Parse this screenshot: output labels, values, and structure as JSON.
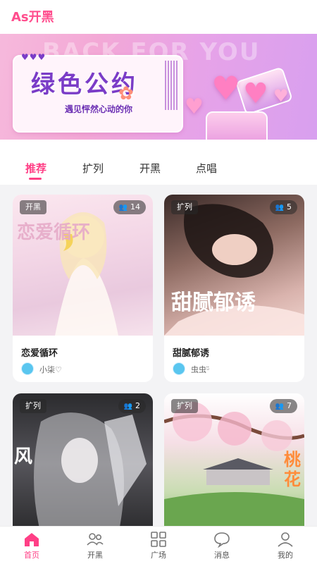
{
  "app": {
    "title": "As开黑"
  },
  "banner": {
    "ghost_text": "BACK FOR YOU",
    "title": "绿色公约",
    "subtitle": "遇见怦然心动的你"
  },
  "tabs": [
    {
      "label": "推荐",
      "active": true
    },
    {
      "label": "扩列",
      "active": false
    },
    {
      "label": "开黑",
      "active": false
    },
    {
      "label": "点唱",
      "active": false
    }
  ],
  "rooms": [
    {
      "tag": "开黑",
      "count": "14",
      "title": "恋爱循环",
      "owner": "小柒♡",
      "cover_text": "恋爱循环"
    },
    {
      "tag": "扩列",
      "count": "5",
      "title": "甜腻郁诱",
      "owner": "虫虫ᵕ̈",
      "cover_text": "甜腻郁诱"
    },
    {
      "tag": "扩列",
      "count": "2",
      "title": "",
      "owner": "",
      "cover_text": "风"
    },
    {
      "tag": "扩列",
      "count": "7",
      "title": "",
      "owner": "",
      "cover_text": "桃花"
    }
  ],
  "bottom_nav": [
    {
      "label": "首页",
      "icon": "home-icon",
      "active": true
    },
    {
      "label": "开黑",
      "icon": "group-icon",
      "active": false
    },
    {
      "label": "广场",
      "icon": "grid-icon",
      "active": false
    },
    {
      "label": "消息",
      "icon": "message-icon",
      "active": false
    },
    {
      "label": "我的",
      "icon": "profile-icon",
      "active": false
    }
  ],
  "colors": {
    "accent": "#ff3f86",
    "brand": "#ff4d8d"
  }
}
